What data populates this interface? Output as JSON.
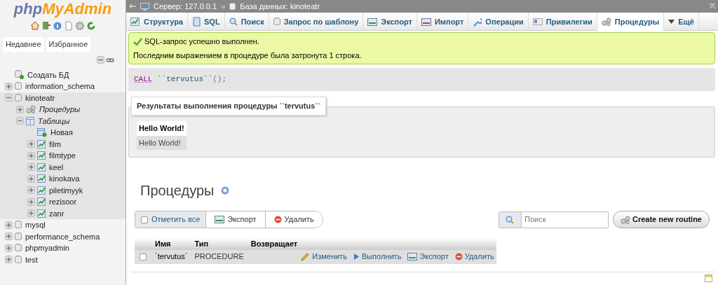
{
  "logo": {
    "part_1": "php",
    "part_2": "MyAdmin"
  },
  "sidebar": {
    "tabs": [
      {
        "label": "Недавнее"
      },
      {
        "label": "Избранное"
      }
    ],
    "tree": [
      {
        "label": "Создать БД",
        "kind": "new",
        "selected": false
      },
      {
        "label": "information_schema",
        "kind": "database",
        "expanded": false,
        "selected": false
      },
      {
        "label": "kinoteatr",
        "kind": "database",
        "expanded": true,
        "selected": true,
        "children": [
          {
            "label": "Процедуры",
            "kind": "group",
            "expanded": false
          },
          {
            "label": "Таблицы",
            "kind": "tables",
            "expanded": true,
            "children": [
              {
                "label": "Новая",
                "kind": "new"
              },
              {
                "label": "film",
                "kind": "table",
                "expanded": false
              },
              {
                "label": "filmtype",
                "kind": "table",
                "expanded": false
              },
              {
                "label": "keel",
                "kind": "table",
                "expanded": false
              },
              {
                "label": "kinokava",
                "kind": "table",
                "expanded": false
              },
              {
                "label": "piletimyyk",
                "kind": "table",
                "expanded": false
              },
              {
                "label": "rezisoor",
                "kind": "table",
                "expanded": false
              },
              {
                "label": "zanr",
                "kind": "table",
                "expanded": false
              }
            ]
          }
        ]
      },
      {
        "label": "mysql",
        "kind": "database",
        "expanded": false,
        "selected": false
      },
      {
        "label": "performance_schema",
        "kind": "database",
        "expanded": false,
        "selected": false
      },
      {
        "label": "phpmyadmin",
        "kind": "database",
        "expanded": false,
        "selected": false
      },
      {
        "label": "test",
        "kind": "database",
        "expanded": false,
        "selected": false
      }
    ]
  },
  "breadcrumb": {
    "items": [
      {
        "label": "Сервер: 127.0.0.1",
        "kind": "server"
      },
      {
        "label": "База данных: kinoteatr",
        "kind": "database"
      }
    ],
    "separator": "»"
  },
  "tabs": [
    {
      "label": "Структура",
      "selected": false
    },
    {
      "label": "SQL",
      "selected": false
    },
    {
      "label": "Поиск",
      "selected": false
    },
    {
      "label": "Запрос по шаблону",
      "selected": false
    },
    {
      "label": "Экспорт",
      "selected": false
    },
    {
      "label": "Импорт",
      "selected": false
    },
    {
      "label": "Операции",
      "selected": false
    },
    {
      "label": "Привилегии",
      "selected": false
    },
    {
      "label": "Процедуры",
      "selected": true
    },
    {
      "label": "Ещё",
      "selected": false
    }
  ],
  "success": {
    "title": "SQL-запрос успешно выполнен.",
    "message": "Последним выражением в процедуре была затронута 1 строка."
  },
  "sql": {
    "keyword": "CALL",
    "identifier": "``tervutus``",
    "punctuation": "();"
  },
  "results": {
    "legend": "Результаты выполнения процедуры ``tervutus``",
    "column": "Hello World!",
    "rows": [
      "Hello World!"
    ]
  },
  "routines": {
    "title": "Процедуры",
    "check_all": {
      "label": "Отметить все",
      "checked": false
    },
    "bulk_actions": [
      {
        "label": "Экспорт",
        "kind": "export"
      },
      {
        "label": "Удалить",
        "kind": "delete"
      }
    ],
    "search": {
      "placeholder": "Поиск"
    },
    "create_button": "Create new routine",
    "table": {
      "columns": [
        "Имя",
        "Тип",
        "Возвращает"
      ],
      "rows": [
        {
          "checked": false,
          "name": "`tervutus`",
          "type": "PROCEDURE",
          "actions": [
            {
              "label": "Изменить",
              "kind": "edit"
            },
            {
              "label": "Выполнить",
              "kind": "execute"
            },
            {
              "label": "Экспорт",
              "kind": "export"
            },
            {
              "label": "Удалить",
              "kind": "delete"
            }
          ]
        }
      ]
    }
  }
}
